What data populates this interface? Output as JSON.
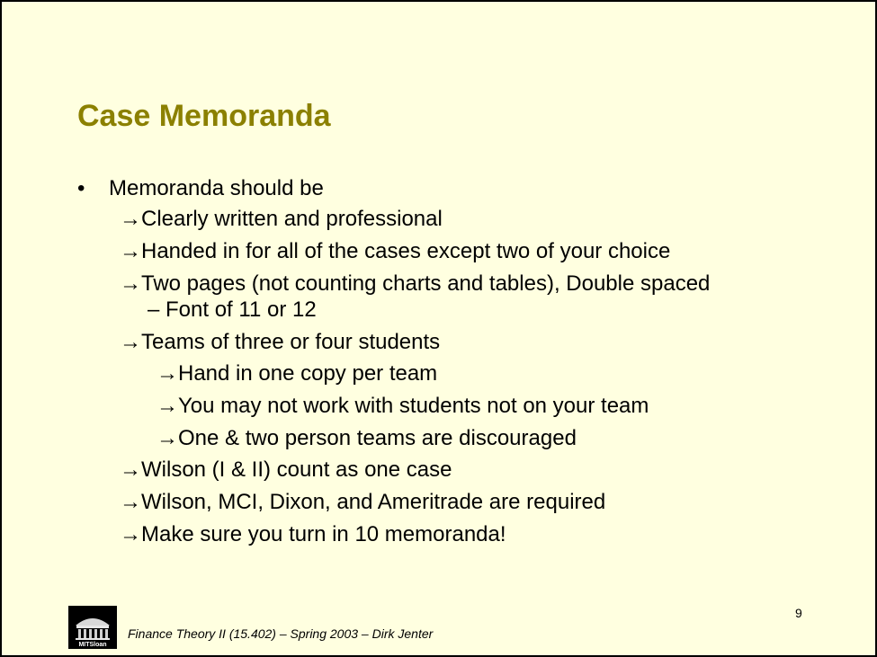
{
  "title": "Case Memoranda",
  "bullet": "•",
  "arrow": "→",
  "level1": "Memoranda should be",
  "items": [
    "Clearly written and professional",
    "Handed in for all of the cases except two of your choice",
    "Two pages (not counting charts and tables), Double spaced",
    "– Font of 11 or 12",
    "Teams of three or four students",
    "Hand in one copy per team",
    "You may not work with students not on your team",
    "One & two person teams are discouraged",
    "Wilson (I & II) count as one case",
    "Wilson, MCI, Dixon, and Ameritrade are required",
    "Make sure you turn in 10 memoranda!"
  ],
  "footer": "Finance Theory II (15.402) – Spring 2003 – Dirk Jenter",
  "page_number": "9",
  "logo_text": "MITSloan",
  "colors": {
    "background": "#ffffe0",
    "title": "#8b8000",
    "text": "#000000"
  }
}
